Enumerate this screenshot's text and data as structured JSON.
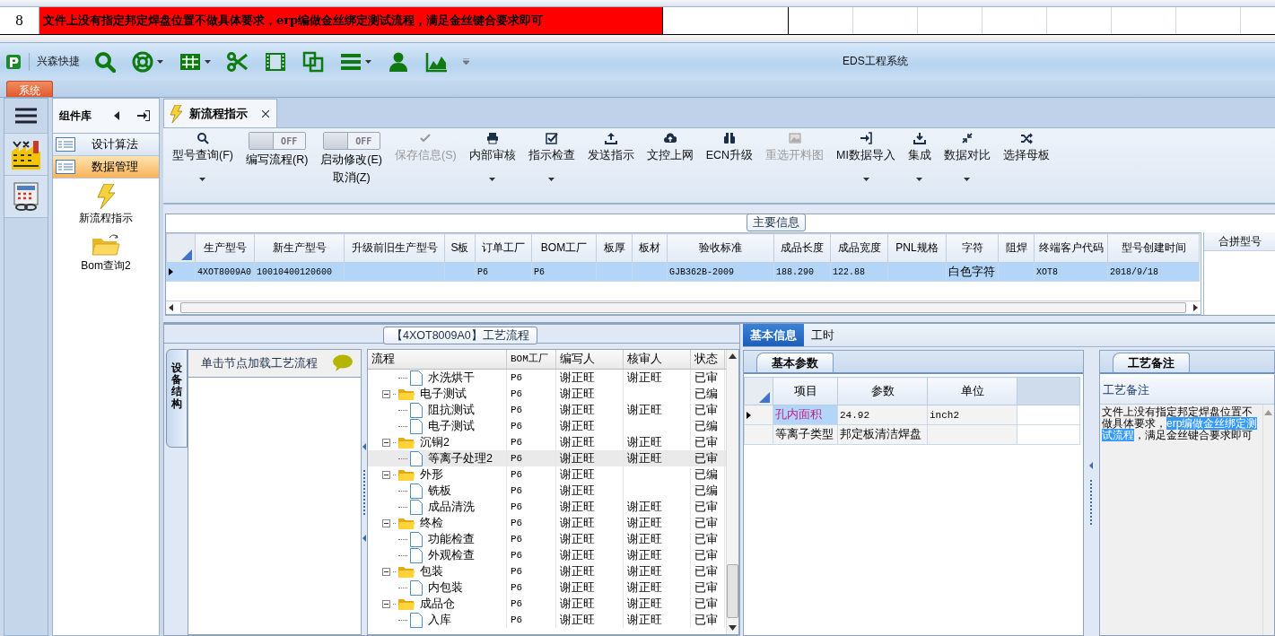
{
  "sheet": {
    "row_number": "8",
    "cell_text": "文件上没有指定邦定焊盘位置不做具体要求，erp编做金丝绑定测试流程，满足金丝键合要求即可"
  },
  "window": {
    "title": "EDS工程系统",
    "app_label": "兴森快捷"
  },
  "menu_tab": {
    "label": "系统"
  },
  "component_panel": {
    "title": "组件库",
    "categories": [
      {
        "label": "设计算法",
        "selected": false
      },
      {
        "label": "数据管理",
        "selected": true
      }
    ],
    "items": [
      {
        "kind": "lightning",
        "label": "新流程指示"
      },
      {
        "kind": "folder",
        "label": "Bom查询2"
      }
    ]
  },
  "doc_tabs": [
    {
      "label": "新流程指示",
      "selected": true
    }
  ],
  "ribbon": [
    {
      "kind": "button",
      "labels": [
        "型号查询(F)"
      ],
      "dropdown": true,
      "disabled": false
    },
    {
      "kind": "toggle",
      "labels": [
        "编写流程(R)"
      ],
      "state_text": "OFF",
      "on": false
    },
    {
      "kind": "toggle",
      "labels": [
        "启动修改(E)",
        "取消(Z)"
      ],
      "state_text": "OFF",
      "on": false
    },
    {
      "kind": "button",
      "labels": [
        "保存信息(S)"
      ],
      "dropdown": false,
      "disabled": true
    },
    {
      "kind": "button",
      "labels": [
        "内部审核"
      ],
      "dropdown": true,
      "disabled": false
    },
    {
      "kind": "button",
      "labels": [
        "指示检查"
      ],
      "dropdown": true,
      "disabled": false
    },
    {
      "kind": "button",
      "labels": [
        "发送指示"
      ],
      "dropdown": false,
      "disabled": false
    },
    {
      "kind": "button",
      "labels": [
        "文控上网"
      ],
      "dropdown": false,
      "disabled": false
    },
    {
      "kind": "button",
      "labels": [
        "ECN升级"
      ],
      "dropdown": false,
      "disabled": false
    },
    {
      "kind": "button",
      "labels": [
        "重选开料图"
      ],
      "dropdown": false,
      "disabled": true
    },
    {
      "kind": "button",
      "labels": [
        "MI数据导入"
      ],
      "dropdown": true,
      "disabled": false
    },
    {
      "kind": "button",
      "labels": [
        "集成"
      ],
      "dropdown": true,
      "disabled": false
    },
    {
      "kind": "button",
      "labels": [
        "数据对比"
      ],
      "dropdown": true,
      "disabled": false
    },
    {
      "kind": "button",
      "labels": [
        "选择母板"
      ],
      "dropdown": false,
      "disabled": false
    }
  ],
  "main_info": {
    "title": "主要信息",
    "columns": [
      "生产型号",
      "新生产型号",
      "升级前旧生产型号",
      "S板",
      "订单工厂",
      "BOM工厂",
      "板厚",
      "板材",
      "验收标准",
      "成品长度",
      "成品宽度",
      "PNL规格",
      "字符",
      "阻焊",
      "终端客户代码",
      "型号创建时间"
    ],
    "rows": [
      {
        "selected": true,
        "cells": [
          "4XOT8009A0",
          "10010400120600",
          "",
          "",
          "P6",
          "P6",
          "",
          "",
          "GJB362B-2009",
          "188.290",
          "122.88",
          "",
          "白色字符",
          "",
          "XOT8",
          "2018/9/18"
        ]
      }
    ],
    "side_column": "合拼型号"
  },
  "process": {
    "title": "【4XOT8009A0】工艺流程",
    "side_tab": "设备结构",
    "hint": "单击节点加载工艺流程",
    "columns": [
      "流程",
      "BOM工厂",
      "编写人",
      "核审人",
      "状态"
    ],
    "tree": [
      {
        "children": [
          {
            "name": "水洗烘干",
            "factory": "P6",
            "writer": "谢正旺",
            "reviewer": "谢正旺",
            "status": "已审",
            "selected": false
          }
        ]
      },
      {
        "name": "电子测试",
        "factory": "P6",
        "writer": "谢正旺",
        "status": "已编",
        "selected": false,
        "expanded": true,
        "children": [
          {
            "name": "阻抗测试",
            "factory": "P6",
            "writer": "谢正旺",
            "reviewer": "谢正旺",
            "status": "已审",
            "selected": false
          },
          {
            "name": "电子测试",
            "factory": "P6",
            "writer": "谢正旺",
            "status": "已编",
            "selected": false
          }
        ]
      },
      {
        "name": "沉铜2",
        "factory": "P6",
        "writer": "谢正旺",
        "reviewer": "谢正旺",
        "status": "已审",
        "selected": false,
        "expanded": true,
        "children": [
          {
            "name": "等离子处理2",
            "factory": "P6",
            "writer": "谢正旺",
            "reviewer": "谢正旺",
            "status": "已审",
            "selected": true
          }
        ]
      },
      {
        "name": "外形",
        "factory": "P6",
        "writer": "谢正旺",
        "status": "已编",
        "selected": false,
        "expanded": true,
        "children": [
          {
            "name": "铣板",
            "factory": "P6",
            "writer": "谢正旺",
            "status": "已编",
            "selected": false
          },
          {
            "name": "成品清洗",
            "factory": "P6",
            "writer": "谢正旺",
            "reviewer": "谢正旺",
            "status": "已审",
            "selected": false
          }
        ]
      },
      {
        "name": "终检",
        "factory": "P6",
        "writer": "谢正旺",
        "reviewer": "谢正旺",
        "status": "已审",
        "selected": false,
        "expanded": true,
        "children": [
          {
            "name": "功能检查",
            "factory": "P6",
            "writer": "谢正旺",
            "reviewer": "谢正旺",
            "status": "已审",
            "selected": false
          },
          {
            "name": "外观检查",
            "factory": "P6",
            "writer": "谢正旺",
            "reviewer": "谢正旺",
            "status": "已审",
            "selected": false
          }
        ]
      },
      {
        "name": "包装",
        "factory": "P6",
        "writer": "谢正旺",
        "reviewer": "谢正旺",
        "status": "已审",
        "selected": false,
        "expanded": true,
        "children": [
          {
            "name": "内包装",
            "factory": "P6",
            "writer": "谢正旺",
            "reviewer": "谢正旺",
            "status": "已审",
            "selected": false
          }
        ]
      },
      {
        "name": "成品仓",
        "factory": "P6",
        "writer": "谢正旺",
        "reviewer": "谢正旺",
        "status": "已审",
        "selected": false,
        "expanded": true,
        "children": [
          {
            "name": "入库",
            "factory": "P6",
            "writer": "谢正旺",
            "reviewer": "谢正旺",
            "status": "已审",
            "selected": false
          }
        ]
      }
    ]
  },
  "details": {
    "tabs": [
      {
        "label": "基本信息",
        "selected": true
      },
      {
        "label": "工时",
        "selected": false
      }
    ],
    "params_tab": "基本参数",
    "params": {
      "columns": [
        "项目",
        "参数",
        "单位"
      ],
      "rows": [
        {
          "selected": true,
          "cells": [
            "孔内面积",
            "24.92",
            "inch2"
          ]
        },
        {
          "selected": false,
          "cells": [
            "等离子类型",
            "邦定板清洁焊盘",
            ""
          ]
        }
      ]
    },
    "notes_tab": "工艺备注",
    "notes_column": "工艺备注",
    "notes": [
      {
        "text": "文件上没有指定邦定焊盘位置不做具体要求，",
        "selected": false
      },
      {
        "text": "erp编做金丝绑定测试流程",
        "selected": true
      },
      {
        "text": "，满足金丝键合要求即可",
        "selected": false
      }
    ]
  }
}
